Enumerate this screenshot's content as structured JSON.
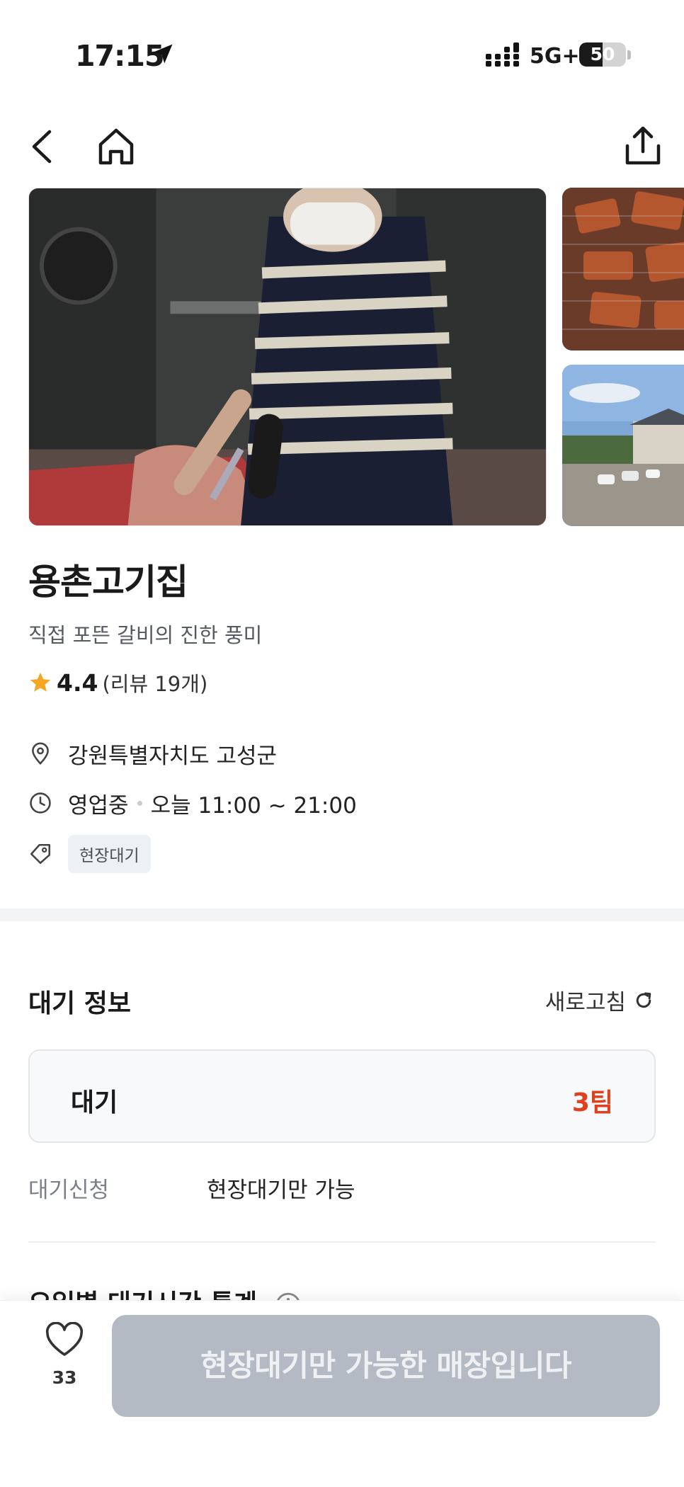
{
  "status_bar": {
    "time": "17:15",
    "network": "5G+",
    "battery_level": "50",
    "battery_fraction": 0.5
  },
  "nav": {
    "back_icon": "chevron-left-icon",
    "home_icon": "home-icon",
    "share_icon": "share-icon"
  },
  "store": {
    "name": "용촌고기집",
    "description": "직접 포뜬 갈비의 진한 풍미",
    "rating": "4.4",
    "reviews": "(리뷰 19개)",
    "address": "강원특별자치도 고성군",
    "status": "영업중",
    "hours": "오늘 11:00 ~ 21:00",
    "tag": "현장대기"
  },
  "wait_info": {
    "title": "대기 정보",
    "refresh_label": "새로고침",
    "wait_label": "대기",
    "wait_count": "3팀",
    "apply_label": "대기신청",
    "apply_value": "현장대기만 가능",
    "stats_title": "요일별 대기시간 통계"
  },
  "bottom_bar": {
    "like_count": "33",
    "cta_label": "현장대기만 가능한 매장입니다"
  },
  "colors": {
    "accent_red": "#e0401c",
    "cta_disabled": "#b4bac3",
    "star": "#f5a623"
  }
}
